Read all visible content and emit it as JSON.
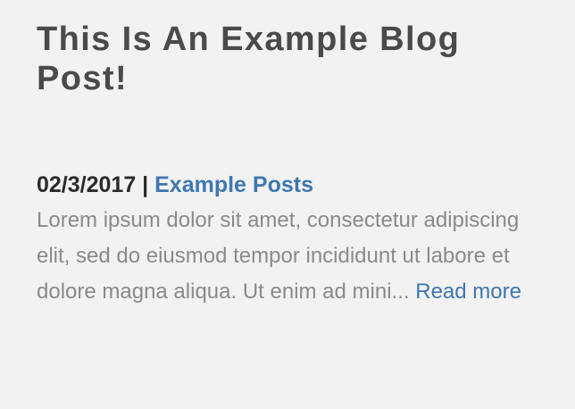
{
  "post": {
    "title": "This Is An Example Blog Post!",
    "date": "02/3/2017",
    "separator": "|",
    "category": "Example Posts",
    "excerpt": "Lorem ipsum dolor sit amet, consectetur adipiscing elit, sed do eiusmod tempor incididunt ut labore et dolore magna aliqua. Ut enim ad mini...",
    "read_more": "Read more"
  },
  "colors": {
    "background": "#f2f2f2",
    "title": "#4a4a4a",
    "meta": "#2b2b2b",
    "link": "#3f77b0",
    "excerpt": "#8a8a8a"
  }
}
